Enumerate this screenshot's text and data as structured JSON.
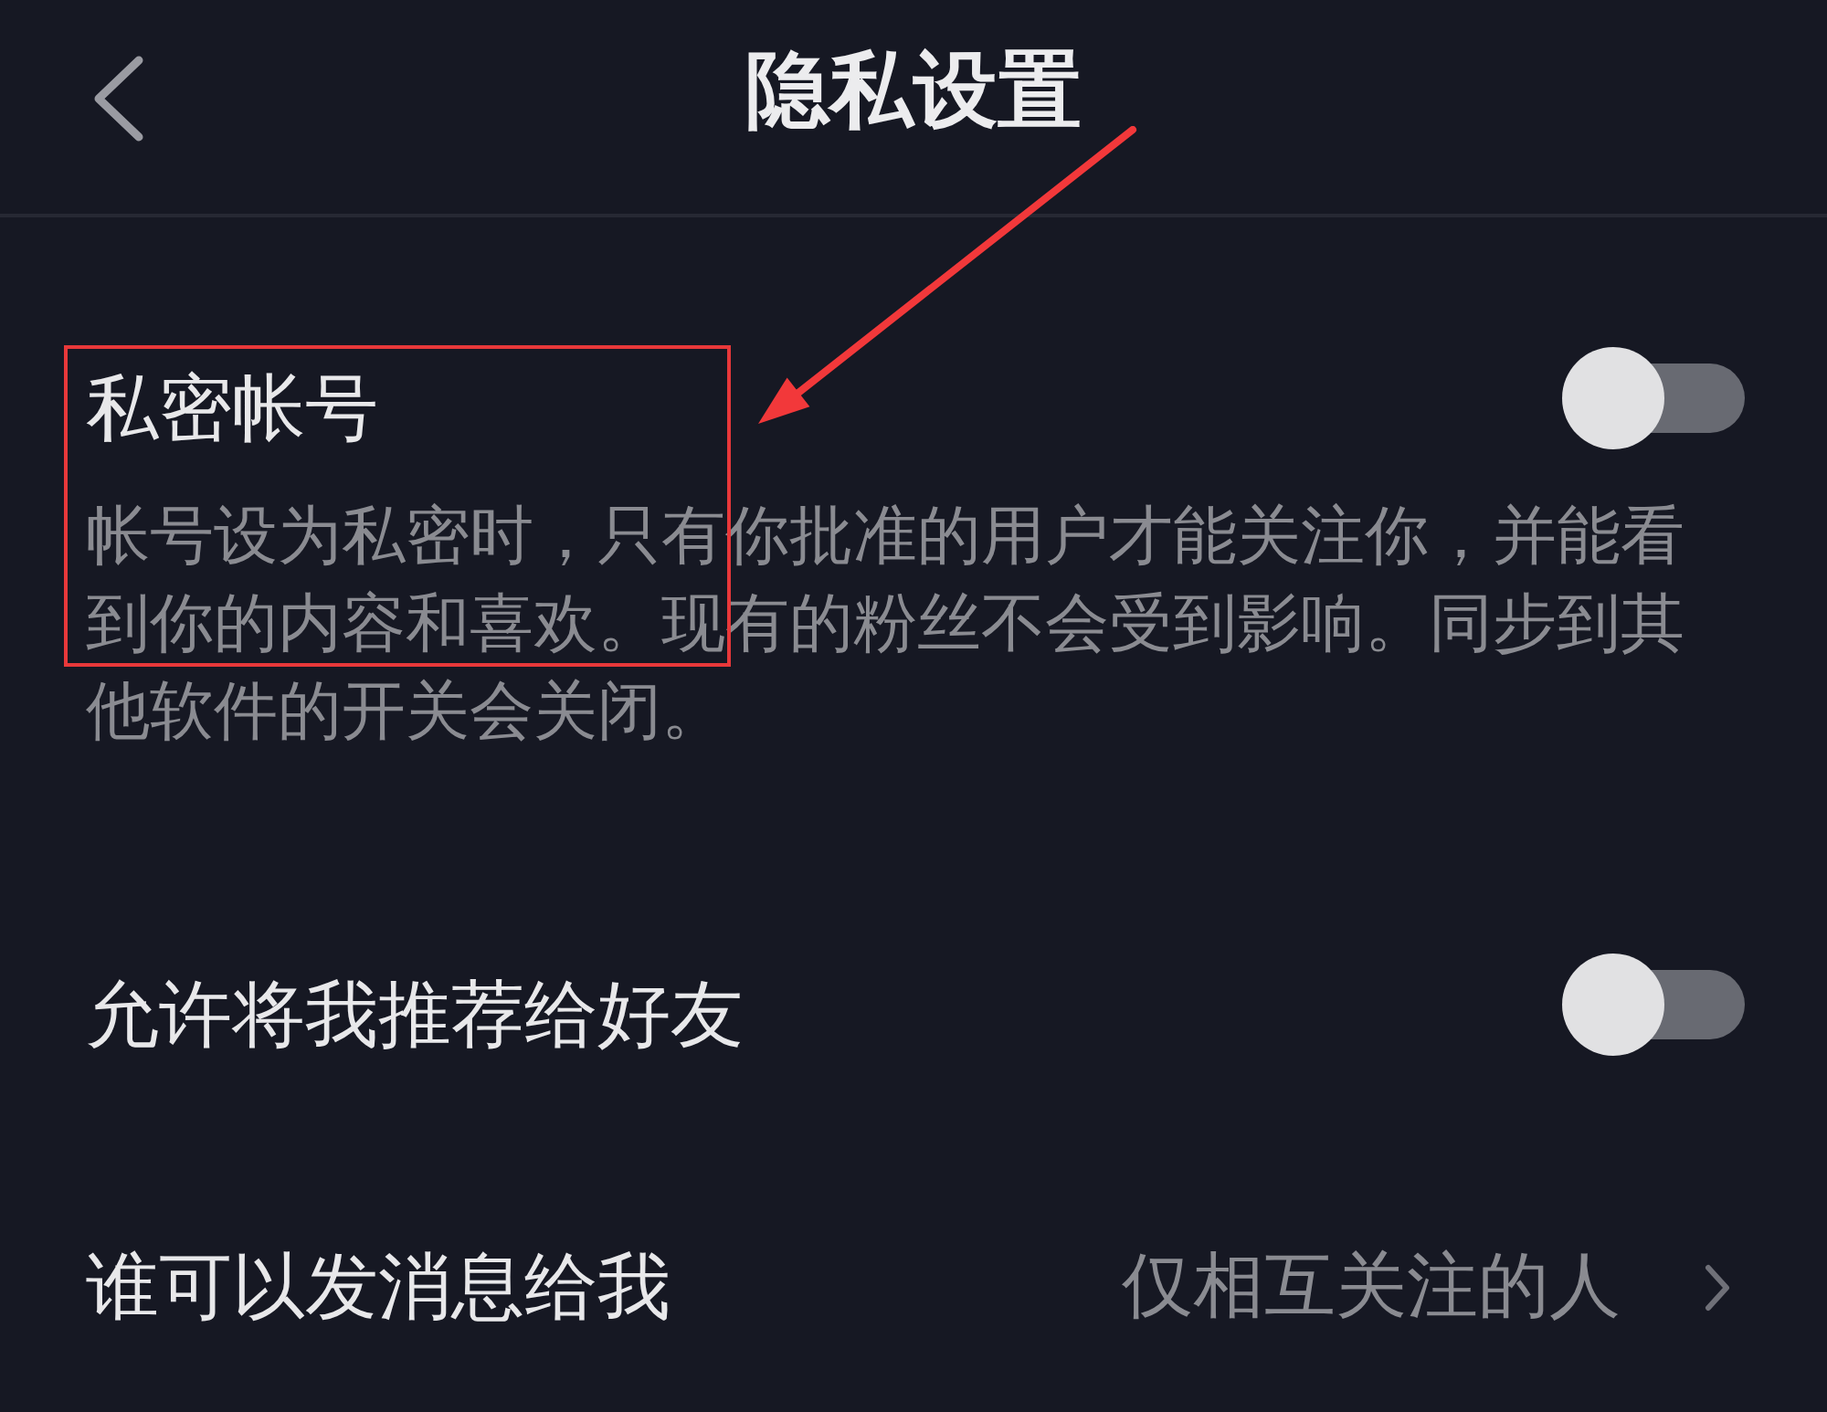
{
  "header": {
    "title": "隐私设置"
  },
  "settings": [
    {
      "kind": "toggle",
      "label": "私密帐号",
      "description": "帐号设为私密时，只有你批准的用户才能关注你，并能看到你的内容和喜欢。现有的粉丝不会受到影响。同步到其他软件的开关会关闭。",
      "on": false,
      "annotated": true
    },
    {
      "kind": "toggle",
      "label": "允许将我推荐给好友",
      "on": false,
      "annotated": false
    },
    {
      "kind": "link",
      "label": "谁可以发消息给我",
      "value": "仅相互关注的人",
      "annotated": false
    }
  ]
}
